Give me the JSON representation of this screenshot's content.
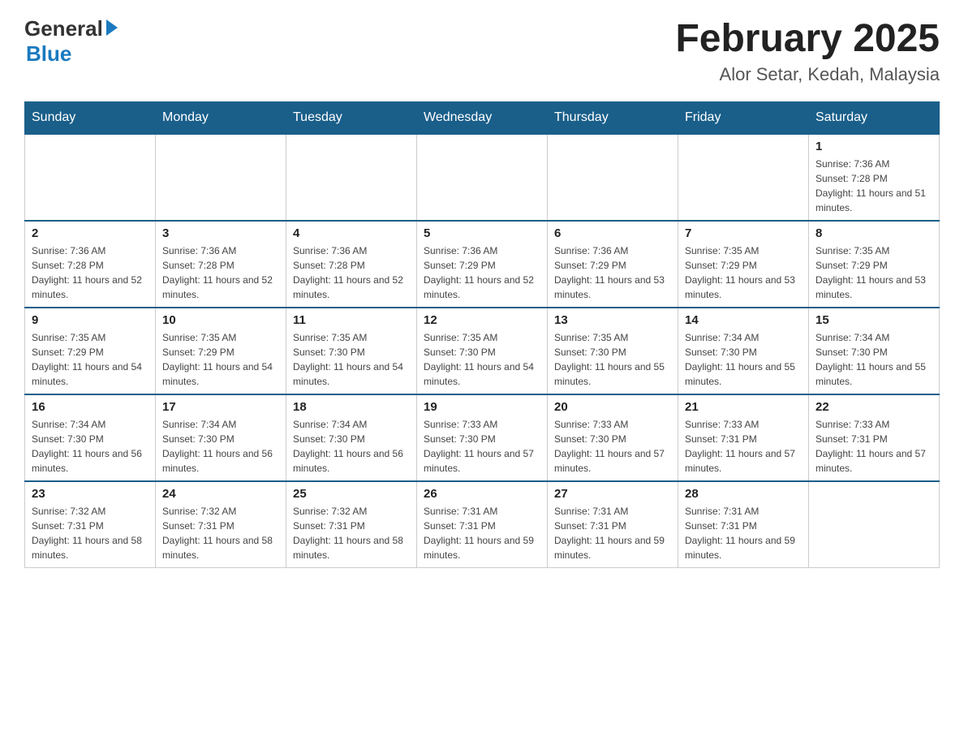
{
  "header": {
    "logo_general": "General",
    "logo_blue": "Blue",
    "month_title": "February 2025",
    "location": "Alor Setar, Kedah, Malaysia"
  },
  "days_of_week": [
    "Sunday",
    "Monday",
    "Tuesday",
    "Wednesday",
    "Thursday",
    "Friday",
    "Saturday"
  ],
  "weeks": [
    [
      {
        "day": "",
        "sunrise": "",
        "sunset": "",
        "daylight": "",
        "empty": true
      },
      {
        "day": "",
        "sunrise": "",
        "sunset": "",
        "daylight": "",
        "empty": true
      },
      {
        "day": "",
        "sunrise": "",
        "sunset": "",
        "daylight": "",
        "empty": true
      },
      {
        "day": "",
        "sunrise": "",
        "sunset": "",
        "daylight": "",
        "empty": true
      },
      {
        "day": "",
        "sunrise": "",
        "sunset": "",
        "daylight": "",
        "empty": true
      },
      {
        "day": "",
        "sunrise": "",
        "sunset": "",
        "daylight": "",
        "empty": true
      },
      {
        "day": "1",
        "sunrise": "Sunrise: 7:36 AM",
        "sunset": "Sunset: 7:28 PM",
        "daylight": "Daylight: 11 hours and 51 minutes.",
        "empty": false
      }
    ],
    [
      {
        "day": "2",
        "sunrise": "Sunrise: 7:36 AM",
        "sunset": "Sunset: 7:28 PM",
        "daylight": "Daylight: 11 hours and 52 minutes.",
        "empty": false
      },
      {
        "day": "3",
        "sunrise": "Sunrise: 7:36 AM",
        "sunset": "Sunset: 7:28 PM",
        "daylight": "Daylight: 11 hours and 52 minutes.",
        "empty": false
      },
      {
        "day": "4",
        "sunrise": "Sunrise: 7:36 AM",
        "sunset": "Sunset: 7:28 PM",
        "daylight": "Daylight: 11 hours and 52 minutes.",
        "empty": false
      },
      {
        "day": "5",
        "sunrise": "Sunrise: 7:36 AM",
        "sunset": "Sunset: 7:29 PM",
        "daylight": "Daylight: 11 hours and 52 minutes.",
        "empty": false
      },
      {
        "day": "6",
        "sunrise": "Sunrise: 7:36 AM",
        "sunset": "Sunset: 7:29 PM",
        "daylight": "Daylight: 11 hours and 53 minutes.",
        "empty": false
      },
      {
        "day": "7",
        "sunrise": "Sunrise: 7:35 AM",
        "sunset": "Sunset: 7:29 PM",
        "daylight": "Daylight: 11 hours and 53 minutes.",
        "empty": false
      },
      {
        "day": "8",
        "sunrise": "Sunrise: 7:35 AM",
        "sunset": "Sunset: 7:29 PM",
        "daylight": "Daylight: 11 hours and 53 minutes.",
        "empty": false
      }
    ],
    [
      {
        "day": "9",
        "sunrise": "Sunrise: 7:35 AM",
        "sunset": "Sunset: 7:29 PM",
        "daylight": "Daylight: 11 hours and 54 minutes.",
        "empty": false
      },
      {
        "day": "10",
        "sunrise": "Sunrise: 7:35 AM",
        "sunset": "Sunset: 7:29 PM",
        "daylight": "Daylight: 11 hours and 54 minutes.",
        "empty": false
      },
      {
        "day": "11",
        "sunrise": "Sunrise: 7:35 AM",
        "sunset": "Sunset: 7:30 PM",
        "daylight": "Daylight: 11 hours and 54 minutes.",
        "empty": false
      },
      {
        "day": "12",
        "sunrise": "Sunrise: 7:35 AM",
        "sunset": "Sunset: 7:30 PM",
        "daylight": "Daylight: 11 hours and 54 minutes.",
        "empty": false
      },
      {
        "day": "13",
        "sunrise": "Sunrise: 7:35 AM",
        "sunset": "Sunset: 7:30 PM",
        "daylight": "Daylight: 11 hours and 55 minutes.",
        "empty": false
      },
      {
        "day": "14",
        "sunrise": "Sunrise: 7:34 AM",
        "sunset": "Sunset: 7:30 PM",
        "daylight": "Daylight: 11 hours and 55 minutes.",
        "empty": false
      },
      {
        "day": "15",
        "sunrise": "Sunrise: 7:34 AM",
        "sunset": "Sunset: 7:30 PM",
        "daylight": "Daylight: 11 hours and 55 minutes.",
        "empty": false
      }
    ],
    [
      {
        "day": "16",
        "sunrise": "Sunrise: 7:34 AM",
        "sunset": "Sunset: 7:30 PM",
        "daylight": "Daylight: 11 hours and 56 minutes.",
        "empty": false
      },
      {
        "day": "17",
        "sunrise": "Sunrise: 7:34 AM",
        "sunset": "Sunset: 7:30 PM",
        "daylight": "Daylight: 11 hours and 56 minutes.",
        "empty": false
      },
      {
        "day": "18",
        "sunrise": "Sunrise: 7:34 AM",
        "sunset": "Sunset: 7:30 PM",
        "daylight": "Daylight: 11 hours and 56 minutes.",
        "empty": false
      },
      {
        "day": "19",
        "sunrise": "Sunrise: 7:33 AM",
        "sunset": "Sunset: 7:30 PM",
        "daylight": "Daylight: 11 hours and 57 minutes.",
        "empty": false
      },
      {
        "day": "20",
        "sunrise": "Sunrise: 7:33 AM",
        "sunset": "Sunset: 7:30 PM",
        "daylight": "Daylight: 11 hours and 57 minutes.",
        "empty": false
      },
      {
        "day": "21",
        "sunrise": "Sunrise: 7:33 AM",
        "sunset": "Sunset: 7:31 PM",
        "daylight": "Daylight: 11 hours and 57 minutes.",
        "empty": false
      },
      {
        "day": "22",
        "sunrise": "Sunrise: 7:33 AM",
        "sunset": "Sunset: 7:31 PM",
        "daylight": "Daylight: 11 hours and 57 minutes.",
        "empty": false
      }
    ],
    [
      {
        "day": "23",
        "sunrise": "Sunrise: 7:32 AM",
        "sunset": "Sunset: 7:31 PM",
        "daylight": "Daylight: 11 hours and 58 minutes.",
        "empty": false
      },
      {
        "day": "24",
        "sunrise": "Sunrise: 7:32 AM",
        "sunset": "Sunset: 7:31 PM",
        "daylight": "Daylight: 11 hours and 58 minutes.",
        "empty": false
      },
      {
        "day": "25",
        "sunrise": "Sunrise: 7:32 AM",
        "sunset": "Sunset: 7:31 PM",
        "daylight": "Daylight: 11 hours and 58 minutes.",
        "empty": false
      },
      {
        "day": "26",
        "sunrise": "Sunrise: 7:31 AM",
        "sunset": "Sunset: 7:31 PM",
        "daylight": "Daylight: 11 hours and 59 minutes.",
        "empty": false
      },
      {
        "day": "27",
        "sunrise": "Sunrise: 7:31 AM",
        "sunset": "Sunset: 7:31 PM",
        "daylight": "Daylight: 11 hours and 59 minutes.",
        "empty": false
      },
      {
        "day": "28",
        "sunrise": "Sunrise: 7:31 AM",
        "sunset": "Sunset: 7:31 PM",
        "daylight": "Daylight: 11 hours and 59 minutes.",
        "empty": false
      },
      {
        "day": "",
        "sunrise": "",
        "sunset": "",
        "daylight": "",
        "empty": true
      }
    ]
  ]
}
